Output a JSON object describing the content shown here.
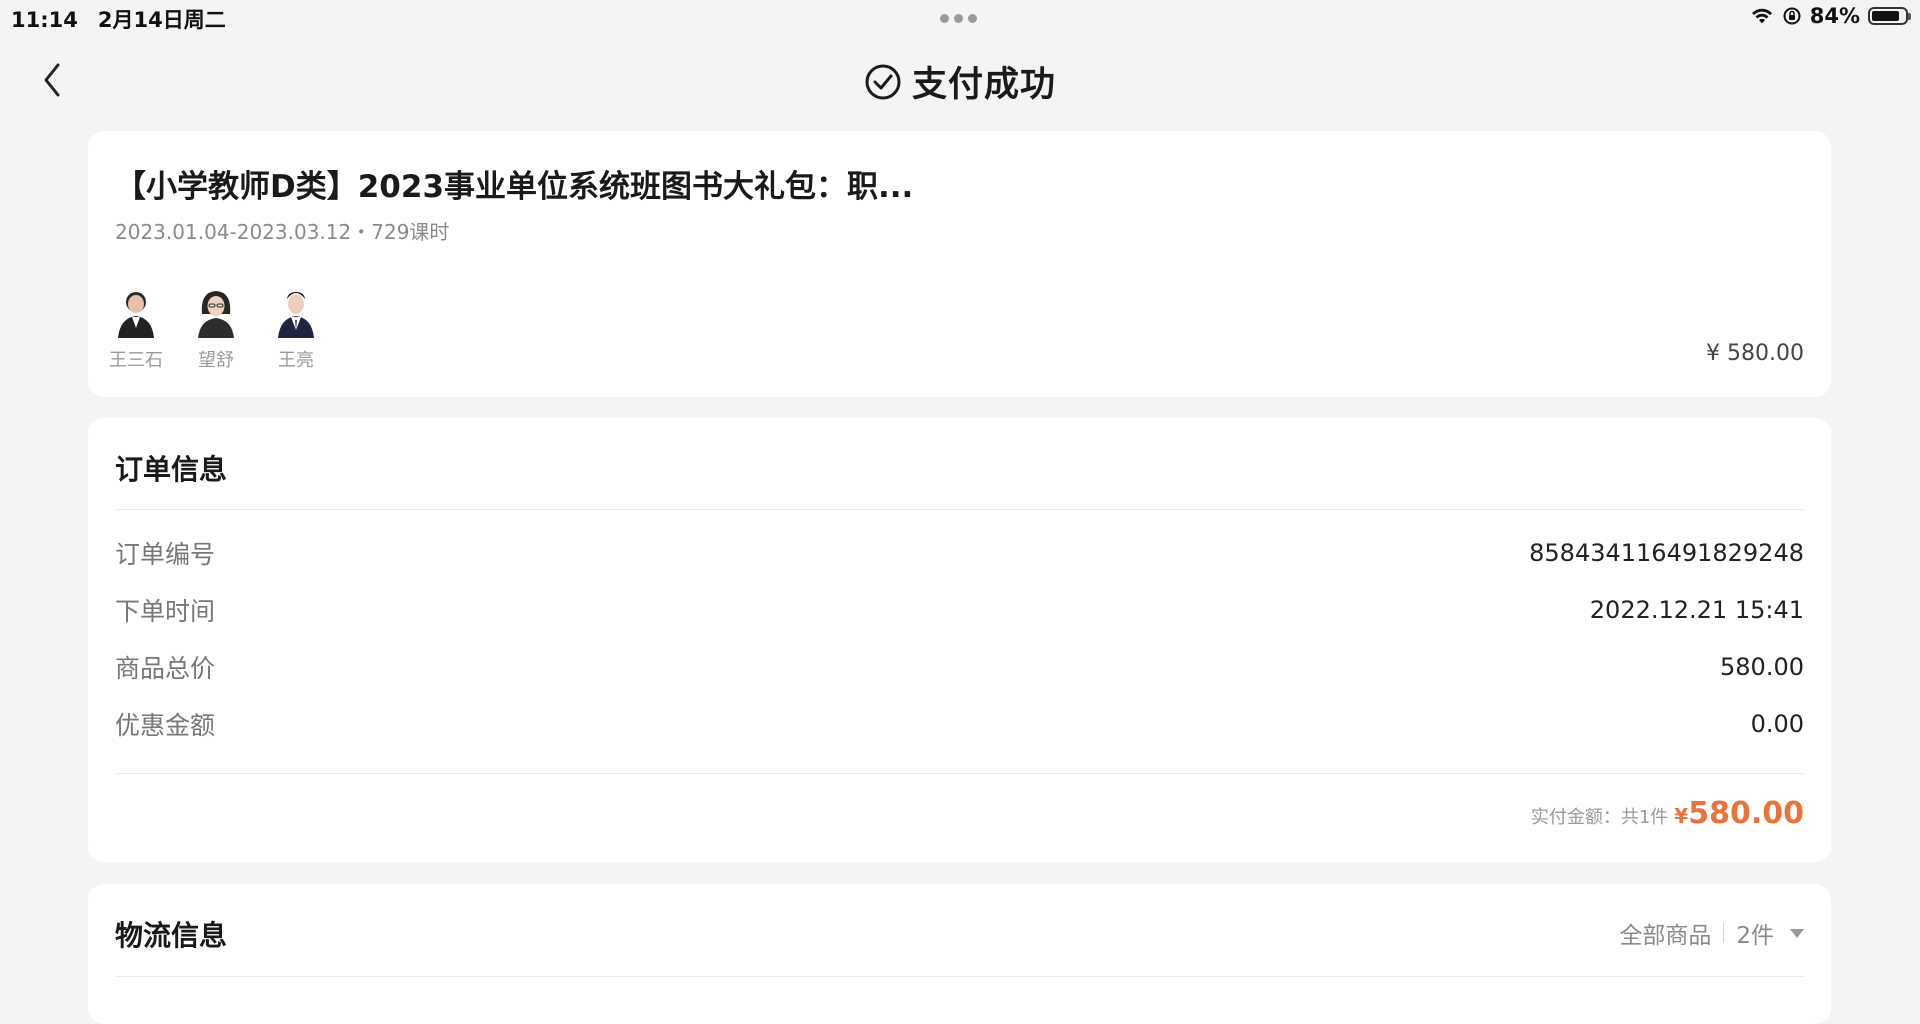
{
  "status_bar": {
    "time": "11:14",
    "date": "2月14日周二",
    "battery": "84%",
    "battery_level": 0.84
  },
  "nav": {
    "title": "支付成功"
  },
  "product": {
    "title": "【小学教师D类】2023事业单位系统班图书大礼包：职...",
    "meta": "2023.01.04-2023.03.12・729课时",
    "teachers": [
      {
        "name": "王三石"
      },
      {
        "name": "望舒"
      },
      {
        "name": "王亮"
      }
    ],
    "price": "¥ 580.00"
  },
  "order": {
    "title": "订单信息",
    "rows": [
      {
        "label": "订单编号",
        "value": "858434116491829248"
      },
      {
        "label": "下单时间",
        "value": "2022.12.21 15:41"
      },
      {
        "label": "商品总价",
        "value": "580.00"
      },
      {
        "label": "优惠金额",
        "value": "0.00"
      }
    ],
    "paid_label": "实付金额：共1件",
    "paid_currency": "¥",
    "paid_amount": "580.00"
  },
  "logistics": {
    "title": "物流信息",
    "filter_label": "全部商品",
    "filter_count": "2件"
  },
  "colors": {
    "accent": "#e8743b",
    "background": "#f4f4f5"
  }
}
